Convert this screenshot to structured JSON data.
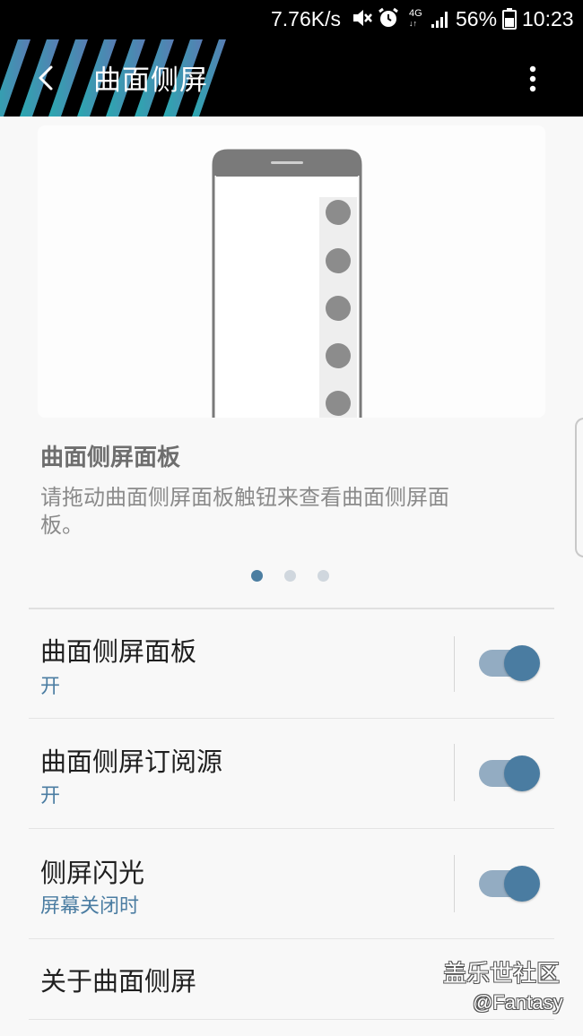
{
  "status_bar": {
    "net_speed": "7.76K/s",
    "network_type": "4G",
    "battery_percent": "56%",
    "time": "10:23",
    "icons": [
      "mute-icon",
      "alarm-icon",
      "signal-icon",
      "battery-icon"
    ]
  },
  "app_bar": {
    "title": "曲面侧屏",
    "back_icon": "chevron-left-icon",
    "more_icon": "more-vertical-icon"
  },
  "illustration": {
    "pager": {
      "page_count": 3,
      "active_index": 0
    }
  },
  "panel_info": {
    "title": "曲面侧屏面板",
    "description": "请拖动曲面侧屏面板触钮来查看曲面侧屏面板。"
  },
  "settings": [
    {
      "title": "曲面侧屏面板",
      "subtitle": "开",
      "toggle_on": true
    },
    {
      "title": "曲面侧屏订阅源",
      "subtitle": "开",
      "toggle_on": true
    },
    {
      "title": "侧屏闪光",
      "subtitle": "屏幕关闭时",
      "toggle_on": true
    },
    {
      "title": "关于曲面侧屏"
    }
  ],
  "watermark": {
    "site": "盖乐世社区",
    "user": "@Fantasy"
  },
  "colors": {
    "accent": "#4a7ca1",
    "toggle_track": "#93acc2",
    "subtitle": "#4b7da2",
    "appbar_bg": "#000000",
    "page_bg": "#f8f8f8"
  }
}
